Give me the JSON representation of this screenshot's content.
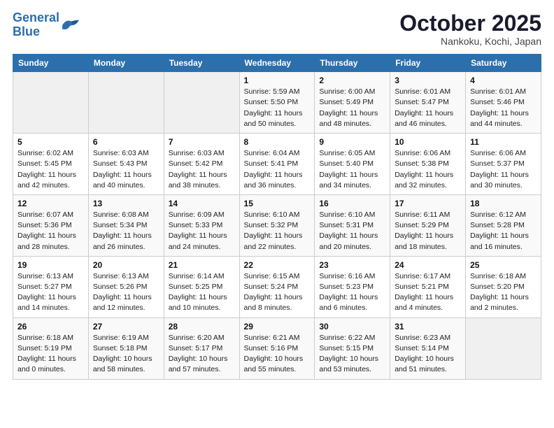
{
  "header": {
    "logo_line1": "General",
    "logo_line2": "Blue",
    "title": "October 2025",
    "subtitle": "Nankoku, Kochi, Japan"
  },
  "weekdays": [
    "Sunday",
    "Monday",
    "Tuesday",
    "Wednesday",
    "Thursday",
    "Friday",
    "Saturday"
  ],
  "weeks": [
    [
      {
        "day": "",
        "empty": true
      },
      {
        "day": "",
        "empty": true
      },
      {
        "day": "",
        "empty": true
      },
      {
        "day": "1",
        "info": "Sunrise: 5:59 AM\nSunset: 5:50 PM\nDaylight: 11 hours\nand 50 minutes."
      },
      {
        "day": "2",
        "info": "Sunrise: 6:00 AM\nSunset: 5:49 PM\nDaylight: 11 hours\nand 48 minutes."
      },
      {
        "day": "3",
        "info": "Sunrise: 6:01 AM\nSunset: 5:47 PM\nDaylight: 11 hours\nand 46 minutes."
      },
      {
        "day": "4",
        "info": "Sunrise: 6:01 AM\nSunset: 5:46 PM\nDaylight: 11 hours\nand 44 minutes."
      }
    ],
    [
      {
        "day": "5",
        "info": "Sunrise: 6:02 AM\nSunset: 5:45 PM\nDaylight: 11 hours\nand 42 minutes."
      },
      {
        "day": "6",
        "info": "Sunrise: 6:03 AM\nSunset: 5:43 PM\nDaylight: 11 hours\nand 40 minutes."
      },
      {
        "day": "7",
        "info": "Sunrise: 6:03 AM\nSunset: 5:42 PM\nDaylight: 11 hours\nand 38 minutes."
      },
      {
        "day": "8",
        "info": "Sunrise: 6:04 AM\nSunset: 5:41 PM\nDaylight: 11 hours\nand 36 minutes."
      },
      {
        "day": "9",
        "info": "Sunrise: 6:05 AM\nSunset: 5:40 PM\nDaylight: 11 hours\nand 34 minutes."
      },
      {
        "day": "10",
        "info": "Sunrise: 6:06 AM\nSunset: 5:38 PM\nDaylight: 11 hours\nand 32 minutes."
      },
      {
        "day": "11",
        "info": "Sunrise: 6:06 AM\nSunset: 5:37 PM\nDaylight: 11 hours\nand 30 minutes."
      }
    ],
    [
      {
        "day": "12",
        "info": "Sunrise: 6:07 AM\nSunset: 5:36 PM\nDaylight: 11 hours\nand 28 minutes."
      },
      {
        "day": "13",
        "info": "Sunrise: 6:08 AM\nSunset: 5:34 PM\nDaylight: 11 hours\nand 26 minutes."
      },
      {
        "day": "14",
        "info": "Sunrise: 6:09 AM\nSunset: 5:33 PM\nDaylight: 11 hours\nand 24 minutes."
      },
      {
        "day": "15",
        "info": "Sunrise: 6:10 AM\nSunset: 5:32 PM\nDaylight: 11 hours\nand 22 minutes."
      },
      {
        "day": "16",
        "info": "Sunrise: 6:10 AM\nSunset: 5:31 PM\nDaylight: 11 hours\nand 20 minutes."
      },
      {
        "day": "17",
        "info": "Sunrise: 6:11 AM\nSunset: 5:29 PM\nDaylight: 11 hours\nand 18 minutes."
      },
      {
        "day": "18",
        "info": "Sunrise: 6:12 AM\nSunset: 5:28 PM\nDaylight: 11 hours\nand 16 minutes."
      }
    ],
    [
      {
        "day": "19",
        "info": "Sunrise: 6:13 AM\nSunset: 5:27 PM\nDaylight: 11 hours\nand 14 minutes."
      },
      {
        "day": "20",
        "info": "Sunrise: 6:13 AM\nSunset: 5:26 PM\nDaylight: 11 hours\nand 12 minutes."
      },
      {
        "day": "21",
        "info": "Sunrise: 6:14 AM\nSunset: 5:25 PM\nDaylight: 11 hours\nand 10 minutes."
      },
      {
        "day": "22",
        "info": "Sunrise: 6:15 AM\nSunset: 5:24 PM\nDaylight: 11 hours\nand 8 minutes."
      },
      {
        "day": "23",
        "info": "Sunrise: 6:16 AM\nSunset: 5:23 PM\nDaylight: 11 hours\nand 6 minutes."
      },
      {
        "day": "24",
        "info": "Sunrise: 6:17 AM\nSunset: 5:21 PM\nDaylight: 11 hours\nand 4 minutes."
      },
      {
        "day": "25",
        "info": "Sunrise: 6:18 AM\nSunset: 5:20 PM\nDaylight: 11 hours\nand 2 minutes."
      }
    ],
    [
      {
        "day": "26",
        "info": "Sunrise: 6:18 AM\nSunset: 5:19 PM\nDaylight: 11 hours\nand 0 minutes."
      },
      {
        "day": "27",
        "info": "Sunrise: 6:19 AM\nSunset: 5:18 PM\nDaylight: 10 hours\nand 58 minutes."
      },
      {
        "day": "28",
        "info": "Sunrise: 6:20 AM\nSunset: 5:17 PM\nDaylight: 10 hours\nand 57 minutes."
      },
      {
        "day": "29",
        "info": "Sunrise: 6:21 AM\nSunset: 5:16 PM\nDaylight: 10 hours\nand 55 minutes."
      },
      {
        "day": "30",
        "info": "Sunrise: 6:22 AM\nSunset: 5:15 PM\nDaylight: 10 hours\nand 53 minutes."
      },
      {
        "day": "31",
        "info": "Sunrise: 6:23 AM\nSunset: 5:14 PM\nDaylight: 10 hours\nand 51 minutes."
      },
      {
        "day": "",
        "empty": true
      }
    ]
  ]
}
